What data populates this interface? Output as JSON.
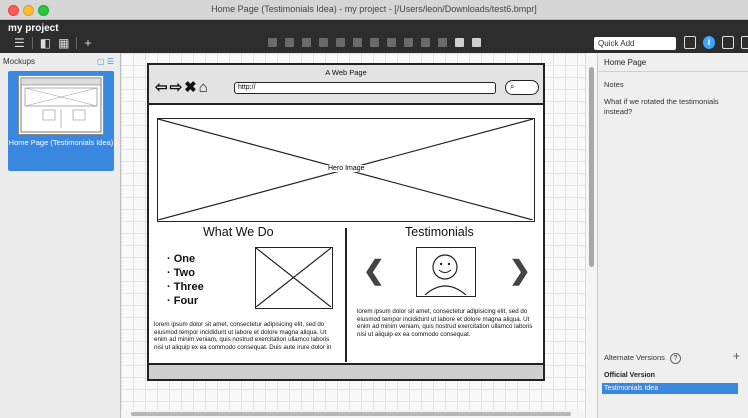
{
  "window": {
    "title": "Home Page (Testimonials Idea) - my project - [/Users/leon/Downloads/test6.bmpr]"
  },
  "app": {
    "project_name": "my project"
  },
  "toolbar": {
    "quick_add_placeholder": "Quick Add",
    "info_glyph": "i"
  },
  "left_panel": {
    "header": "Mockups",
    "mockups": [
      {
        "label": "Home Page (Testimonials Idea)"
      }
    ]
  },
  "mockup": {
    "browser_title": "A Web Page",
    "nav_glyphs": "⇦⇨✖⌂",
    "url": "http://",
    "search_glyph": "⌕",
    "hero_label": "Hero Image",
    "what_we_do": {
      "heading": "What We Do",
      "list": [
        "One",
        "Two",
        "Three",
        "Four"
      ],
      "lorem": "lorem ipsum dolor sit amet, consectetur adipisicing elit, sed do eiusmod tempor incididunt ut labore et dolore magna aliqua. Ut enim ad minim veniam, quis nostrud exercitation ullamco laboris nisi ut aliquip ex ea commodo consequat. Duis aute irure dolor in"
    },
    "testimonials": {
      "heading": "Testimonials",
      "lorem": "lorem ipsum dolor sit amet, consectetur adipisicing elit, sed do eiusmod tempor incididunt ut labore et dolore magna aliqua. Ut enim ad minim veniam, quis nostrud exercitation ullamco laboris nisi ut aliquip ex ea commodo consequat.",
      "prev_glyph": "❮",
      "next_glyph": "❯"
    }
  },
  "right_panel": {
    "header": "Home Page",
    "notes_label": "Notes",
    "notes_text": "What if we rotated the testimonials instead?",
    "alternate_versions_label": "Alternate Versions",
    "help_glyph": "?",
    "add_glyph": "+",
    "versions_group": "Official Version",
    "selected_version": "Testimonials Idea"
  },
  "colors": {
    "selection": "#3a87e0",
    "header_bg": "#2d2d2d"
  }
}
